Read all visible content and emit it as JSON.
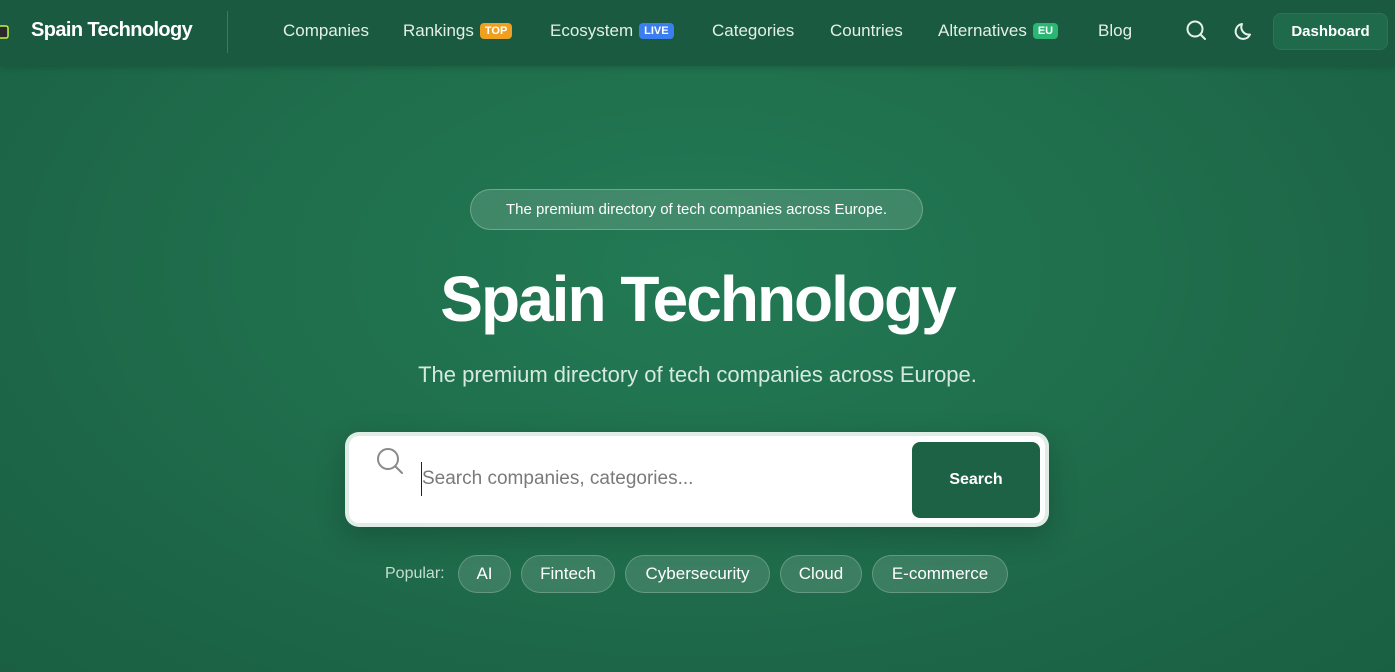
{
  "nav": {
    "brand": "Spain Technology",
    "items": [
      {
        "label": "Companies"
      },
      {
        "label": "Rankings",
        "badge": "TOP",
        "badge_color": "#f0a020"
      },
      {
        "label": "Ecosystem",
        "badge": "LIVE",
        "badge_color": "#3a7ef0"
      },
      {
        "label": "Categories"
      },
      {
        "label": "Countries"
      },
      {
        "label": "Alternatives",
        "badge": "EU",
        "badge_color": "#2bb673"
      },
      {
        "label": "Blog"
      }
    ],
    "icons": [
      "search-icon",
      "moon-icon"
    ],
    "dashboard_label": "Dashboard"
  },
  "hero": {
    "tagline": "The premium directory of tech companies across Europe.",
    "title": "Spain Technology",
    "subtitle": "The premium directory of tech companies across Europe."
  },
  "search": {
    "placeholder": "Search companies, categories...",
    "value": "",
    "button_label": "Search"
  },
  "popular": {
    "label": "Popular:",
    "chips": [
      "AI",
      "Fintech",
      "Cybersecurity",
      "Cloud",
      "E-commerce"
    ]
  },
  "colors": {
    "background": "#1f6e4c",
    "nav": "#1a5a40",
    "search_button": "#1e6246"
  }
}
